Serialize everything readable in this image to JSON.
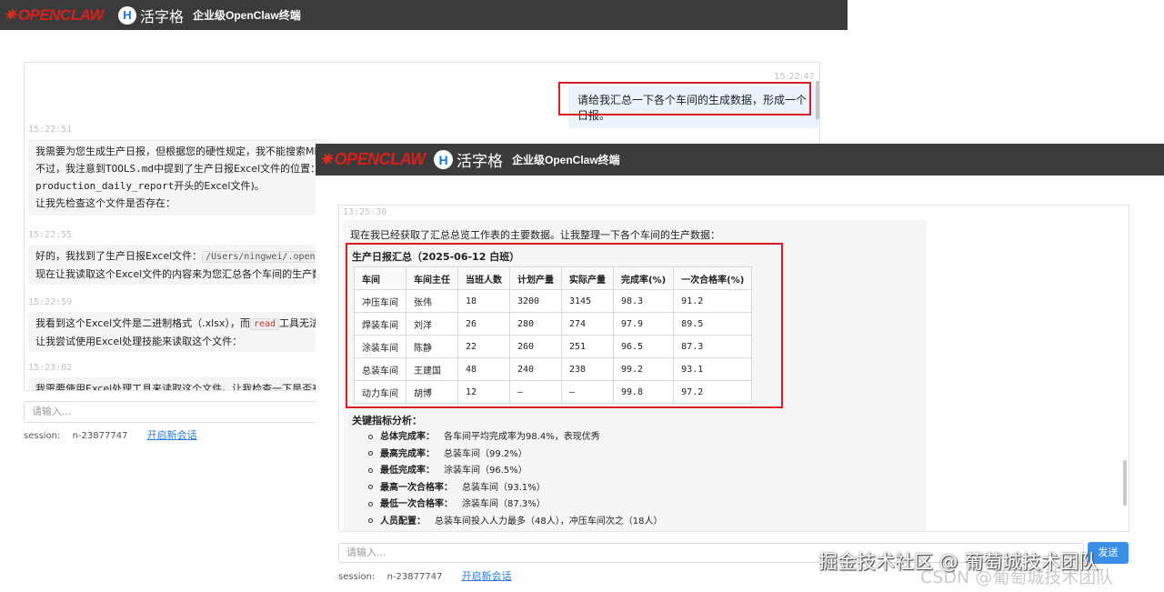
{
  "app": {
    "logo_text": "OPENCLAW",
    "brand_letter": "H",
    "brand_name": "活字格",
    "title": "企业级OpenClaw终端"
  },
  "back_window": {
    "messages": [
      {
        "role": "user",
        "time": "15:22:4?",
        "text": "请给我汇总一下各个车间的生成数据，形成一个日报。"
      },
      {
        "role": "ai",
        "time": "15:22:51",
        "line1": "我需要为您生成生产日报，但根据您的硬性规定，我不能搜索MEMO",
        "line2_pre": "不过，我注意到",
        "line2_code": "TOOLS.md",
        "line2_post": "中提到了生产日报Excel文件的位置：",
        "line3_code": "production_daily_report",
        "line3_post": "开头的Excel文件)。",
        "line4": "让我先检查这个文件是否存在："
      },
      {
        "role": "ai",
        "time": "15:22:55",
        "line1_pre": "好的，我找到了生产日报Excel文件：",
        "line1_code": "/Users/ningwei/.openclaw",
        "line2": "现在让我读取这个Excel文件的内容来为您汇总各个车间的生产数据"
      },
      {
        "role": "ai",
        "time": "15:22:59",
        "line1_pre": "我看到这个Excel文件是二进制格式（.xlsx），而",
        "line1_code": "read",
        "line1_post": "工具无法",
        "line2": "让我尝试使用Excel处理技能来读取这个文件："
      },
      {
        "role": "ai",
        "time": "15:23:02",
        "line1": "我需要使用Excel处理工具来读取这个文件。让我检查一下是否有"
      }
    ],
    "input_placeholder": "请输入...",
    "session_label": "session:",
    "session_id": "n-23877747",
    "new_session_label": "开启新会话"
  },
  "front_window": {
    "message_time": "13:25:30",
    "intro": "现在我已经获取了汇总总览工作表的主要数据。让我整理一下各个车间的生产数据：",
    "table_title": "生产日报汇总（2025-06-12 白班）",
    "table": {
      "headers": [
        "车间",
        "车间主任",
        "当班人数",
        "计划产量",
        "实际产量",
        "完成率(%)",
        "一次合格率(%)"
      ],
      "rows": [
        [
          "冲压车间",
          "张伟",
          "18",
          "3200",
          "3145",
          "98.3",
          "91.2"
        ],
        [
          "焊装车间",
          "刘洋",
          "26",
          "280",
          "274",
          "97.9",
          "89.5"
        ],
        [
          "涂装车间",
          "陈静",
          "22",
          "260",
          "251",
          "96.5",
          "87.3"
        ],
        [
          "总装车间",
          "王建国",
          "48",
          "240",
          "238",
          "99.2",
          "93.1"
        ],
        [
          "动力车间",
          "胡博",
          "12",
          "—",
          "—",
          "99.8",
          "97.2"
        ]
      ]
    },
    "kpi_title": "关键指标分析：",
    "kpis": [
      {
        "label": "总体完成率：",
        "value": "各车间平均完成率为98.4%，表现优秀"
      },
      {
        "label": "最高完成率：",
        "value": "总装车间（99.2%）"
      },
      {
        "label": "最低完成率：",
        "value": "涂装车间（96.5%）"
      },
      {
        "label": "最高一次合格率：",
        "value": "总装车间（93.1%）"
      },
      {
        "label": "最低一次合格率：",
        "value": "涂装车间（87.3%）"
      },
      {
        "label": "人员配置：",
        "value": "总装车间投入人力最多（48人），冲压车间次之（18人）"
      }
    ],
    "input_placeholder": "请输入...",
    "send_label": "发送",
    "session_label": "session:",
    "session_id": "n-23877747",
    "new_session_label": "开启新会话"
  },
  "watermarks": {
    "juejin": "掘金技术社区 @ 葡萄城技术团队",
    "csdn": "CSDN @葡萄城技术团队"
  },
  "colors": {
    "header_bg": "#3b3b3b",
    "highlight_red": "#d81e22",
    "link_blue": "#2b7bd9",
    "send_blue": "#3b8ee8"
  }
}
